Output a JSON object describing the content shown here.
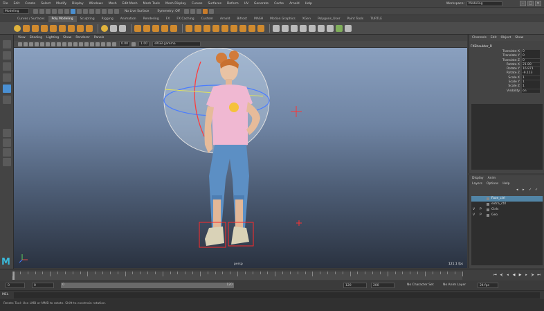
{
  "menubar": {
    "items": [
      "File",
      "Edit",
      "Create",
      "Select",
      "Modify",
      "Display",
      "Windows",
      "Mesh",
      "Edit Mesh",
      "Mesh Tools",
      "Mesh Display",
      "Curves",
      "Surfaces",
      "Deform",
      "UV",
      "Generate",
      "Cache",
      "Arnold",
      "Help"
    ],
    "workspace_label": "Workspace:",
    "workspace_value": "Modeling"
  },
  "statusline": {
    "mode": "Modeling",
    "live_surface": "No Live Surface",
    "symmetry": "Symmetry: Off"
  },
  "shelf_tabs": [
    "Curves / Surfaces",
    "Poly Modeling",
    "Sculpting",
    "Rigging",
    "Animation",
    "Rendering",
    "FX",
    "FX Caching",
    "Custom",
    "Arnold",
    "Bifrost",
    "MASH",
    "Motion Graphics",
    "XGen",
    "Polygons_User",
    "Paint Tools",
    "TURTLE"
  ],
  "shelf_active_tab": "Poly Modeling",
  "panel": {
    "menu": [
      "View",
      "Shading",
      "Lighting",
      "Show",
      "Renderer",
      "Panels"
    ],
    "field_a": "0.00",
    "field_b": "1.00",
    "colorspace": "sRGB gamma"
  },
  "viewport": {
    "camera": "persp",
    "fps": "121.1 fps"
  },
  "channel_box": {
    "menu": [
      "Channels",
      "Edit",
      "Object",
      "Show"
    ],
    "object": "FKShoulder_R",
    "attributes": [
      {
        "name": "Translate X",
        "value": "0"
      },
      {
        "name": "Translate Y",
        "value": "0"
      },
      {
        "name": "Translate Z",
        "value": "0"
      },
      {
        "name": "Rotate X",
        "value": "21.89"
      },
      {
        "name": "Rotate Y",
        "value": "16.871"
      },
      {
        "name": "Rotate Z",
        "value": "-9.113"
      },
      {
        "name": "Scale X",
        "value": "1"
      },
      {
        "name": "Scale Y",
        "value": "1"
      },
      {
        "name": "Scale Z",
        "value": "1"
      },
      {
        "name": "Visibility",
        "value": "on"
      }
    ]
  },
  "layers": {
    "tabs": [
      "Display",
      "Anim"
    ],
    "menu": [
      "Layers",
      "Options",
      "Help"
    ],
    "rows": [
      {
        "v": "",
        "p": "",
        "name": "Face_ctrl",
        "selected": true
      },
      {
        "v": "",
        "p": "",
        "name": "extra_ctrl",
        "selected": false
      },
      {
        "v": "V",
        "p": "P",
        "name": "Ctrls",
        "selected": false
      },
      {
        "v": "V",
        "p": "P",
        "name": "Geo",
        "selected": false
      }
    ]
  },
  "time": {
    "start": "0",
    "range_start": "0",
    "range_end": "120",
    "end_a": "120",
    "end_b": "200",
    "current": "0",
    "char_set": "No Character Set",
    "anim_layer": "No Anim Layer",
    "fps": "24 fps"
  },
  "cmdline": {
    "lang": "MEL"
  },
  "helpline": "Rotate Tool: Use LMB or MMB to rotate. Shift to constrain rotation."
}
